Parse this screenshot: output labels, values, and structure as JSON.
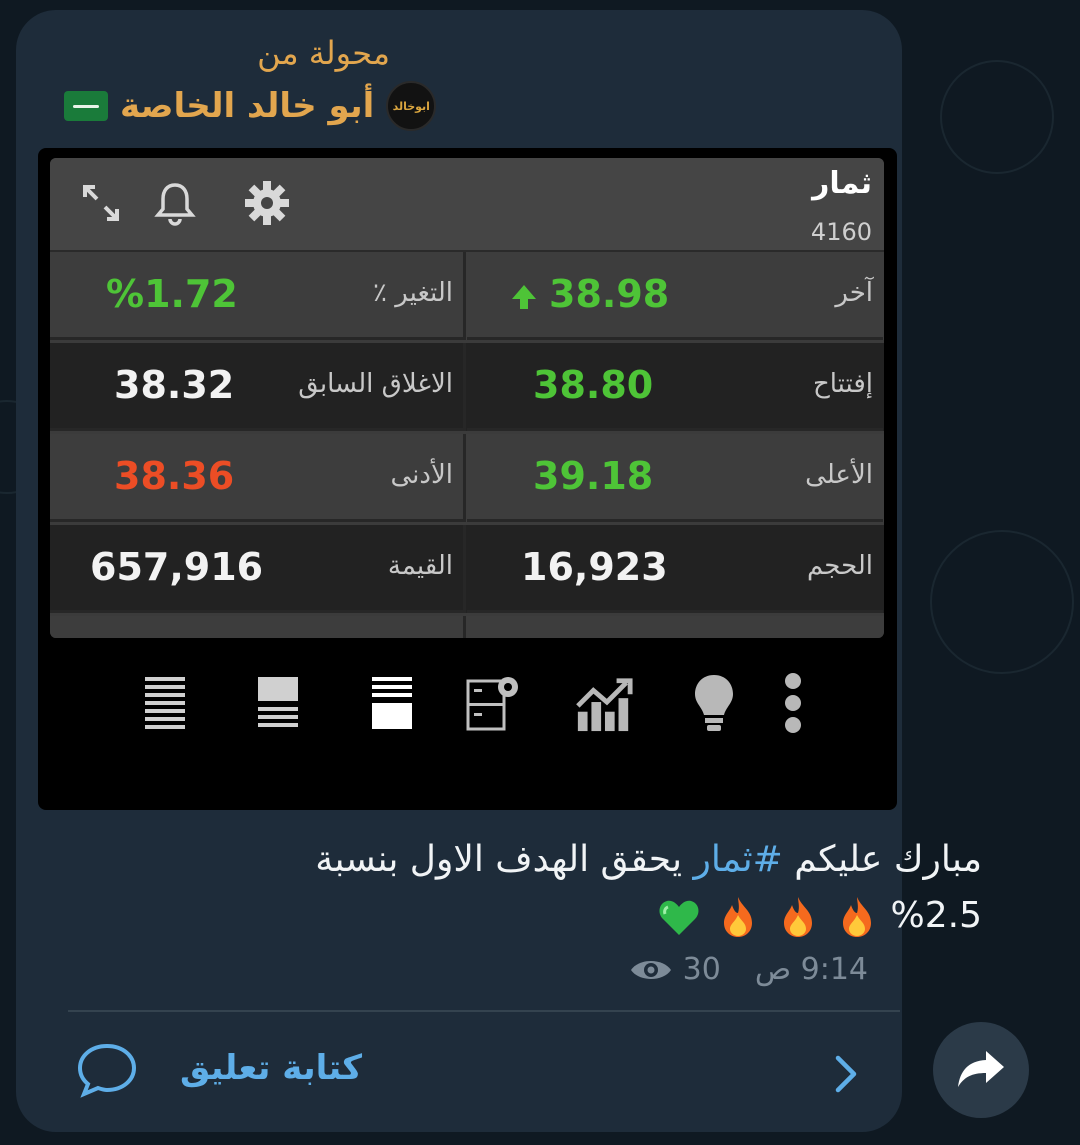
{
  "forward": {
    "label": "محولة من",
    "channel_name": "أبو خالد الخاصة",
    "avatar_text": "ابوخالد",
    "flag_icon": "saudi-flag-icon"
  },
  "widget": {
    "title": "ثمار",
    "code": "4160",
    "icons": [
      "expand-icon",
      "bell-icon",
      "gear-icon"
    ],
    "rows": [
      {
        "right_label": "آخر",
        "right_value": "38.98",
        "right_color": "#4ec437",
        "left_label": "التغير ٪",
        "left_value": "%1.72",
        "left_color": "#4ec437"
      },
      {
        "right_label": "إفتتاح",
        "right_value": "38.80",
        "right_color": "#4ec437",
        "left_label": "الاغلاق السابق",
        "left_value": "38.32",
        "left_color": "#f2f2f2"
      },
      {
        "right_label": "الأعلى",
        "right_value": "39.18",
        "right_color": "#4ec437",
        "left_label": "الأدنى",
        "left_value": "38.36",
        "left_color": "#ec4d25"
      },
      {
        "right_label": "الحجم",
        "right_value": "16,923",
        "right_color": "#f2f2f2",
        "left_label": "القيمة",
        "left_value": "657,916",
        "left_color": "#f2f2f2"
      }
    ]
  },
  "toolbar": {
    "icons": [
      "list-dense-icon",
      "list-icon",
      "list-selected-icon",
      "settings-panel-icon",
      "chart-up-icon",
      "lightbulb-icon",
      "more-vertical-icon"
    ]
  },
  "message": {
    "text_before": "مبارك عليكم ",
    "hashtag": "#ثمار",
    "text_after": " يحقق الهدف الاول بنسبة",
    "line2_text": "%2.5",
    "emojis": [
      "fire",
      "fire",
      "fire",
      "green-heart"
    ],
    "time": "9:14 ص",
    "views": "30",
    "views_icon": "eye-icon"
  },
  "footer": {
    "comment_label": "كتابة تعليق",
    "comment_icon": "comment-bubble-icon",
    "chevron_icon": "chevron-right-icon",
    "share_icon": "share-arrow-icon"
  },
  "colors": {
    "accent": "#e2a64e",
    "link": "#5eaee8",
    "up": "#4ec437",
    "down": "#ec4d25",
    "bubble": "#1e2c3a"
  }
}
